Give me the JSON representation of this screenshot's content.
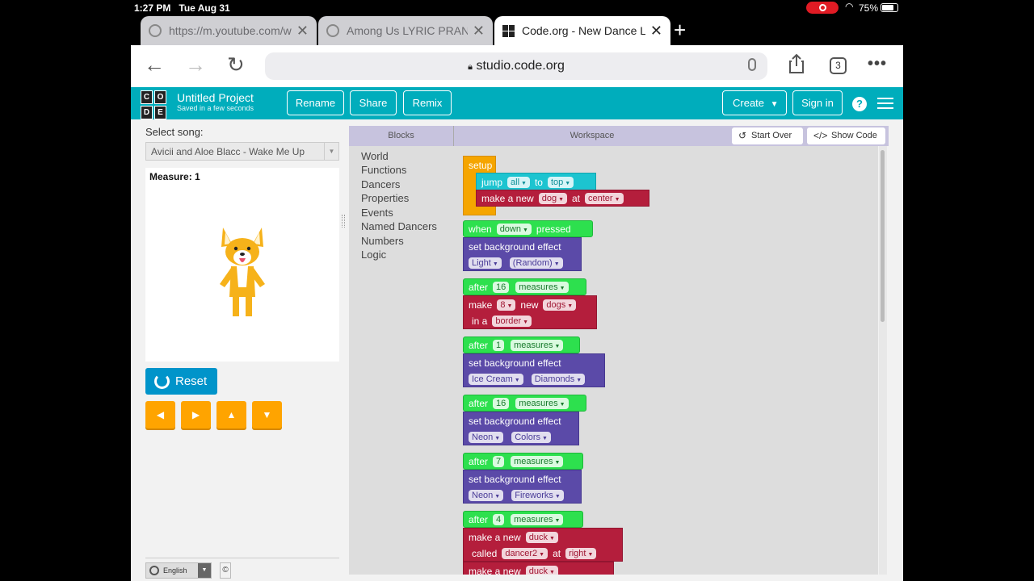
{
  "status": {
    "time": "1:27 PM",
    "date": "Tue Aug 31",
    "battery": "75%",
    "battery_level": 0.75
  },
  "tabs": [
    {
      "label": "https://m.youtube.com/w",
      "active": false
    },
    {
      "label": "Among Us LYRIC PRANK",
      "active": false
    },
    {
      "label": "Code.org - New Dance L",
      "active": true
    }
  ],
  "browser": {
    "url": "studio.code.org",
    "tab_count": "3"
  },
  "header": {
    "logo": [
      "C",
      "O",
      "D",
      "E"
    ],
    "project_title": "Untitled Project",
    "saved_status": "Saved in a few seconds",
    "rename": "Rename",
    "share": "Share",
    "remix": "Remix",
    "create": "Create",
    "sign_in": "Sign in",
    "help": "?"
  },
  "left": {
    "select_song_label": "Select song:",
    "song": "Avicii and Aloe Blacc - Wake Me Up",
    "measure": "Measure: 1",
    "reset": "Reset",
    "language": "English",
    "copyright": "©"
  },
  "workspace": {
    "blocks_label": "Blocks",
    "workspace_label": "Workspace",
    "start_over": "Start Over",
    "show_code": "Show Code",
    "categories": [
      "World",
      "Functions",
      "Dancers",
      "Properties",
      "Events",
      "Named Dancers",
      "Numbers",
      "Logic"
    ]
  },
  "blocks": {
    "setup": "setup",
    "jump": [
      "jump",
      "all",
      "to",
      "top"
    ],
    "make_dog": [
      "make a new",
      "dog",
      "at",
      "center"
    ],
    "when_pressed": [
      "when",
      "down",
      "pressed"
    ],
    "set_bg": "set background effect",
    "bg1": [
      "Light",
      "(Random)"
    ],
    "after1": [
      "after",
      "16",
      "measures"
    ],
    "make_dogs": [
      "make",
      "8",
      "new",
      "dogs"
    ],
    "in_a": [
      "in a",
      "border"
    ],
    "after2": [
      "after",
      "1",
      "measures"
    ],
    "bg2": [
      "Ice Cream",
      "Diamonds"
    ],
    "after3": [
      "after",
      "16",
      "measures"
    ],
    "bg3": [
      "Neon",
      "Colors"
    ],
    "after4": [
      "after",
      "7",
      "measures"
    ],
    "bg4": [
      "Neon",
      "Fireworks"
    ],
    "after5": [
      "after",
      "4",
      "measures"
    ],
    "make_duck": [
      "make a new",
      "duck"
    ],
    "called": [
      "called",
      "dancer2",
      "at",
      "right"
    ],
    "make_duck2": [
      "make a new",
      "duck"
    ]
  },
  "colors": {
    "accent": "#00adbc",
    "event": "#2de04e",
    "effect": "#5b4aa8",
    "dancer": "#b41e3c",
    "setup": "#f5a500",
    "control": "#1cc4d0",
    "reset": "#0094ca",
    "arrow": "#ffa400"
  },
  "icons": [
    "back-arrow-icon",
    "forward-arrow-icon",
    "reload-icon",
    "lock-icon",
    "mic-icon",
    "share-icon",
    "more-icon",
    "globe-icon",
    "close-icon",
    "plus-icon",
    "help-icon",
    "menu-icon",
    "reset-icon",
    "undo-icon",
    "code-icon",
    "corgi-dancer"
  ]
}
